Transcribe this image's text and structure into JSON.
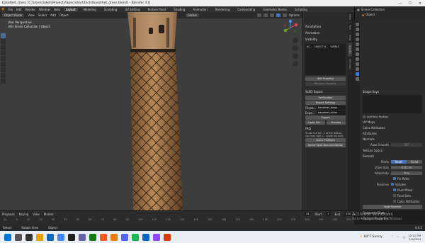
{
  "titlebar": {
    "title": "basethet_dress [C:\\Users\\lakeh\\Projects\\Special\\artifacts\\basethet_dress.blend] - Blender 4.0",
    "min": "—",
    "max": "☐",
    "close": "✕"
  },
  "menubar": {
    "menus": [
      "File",
      "Edit",
      "Render",
      "Window",
      "Help"
    ],
    "workspaces": [
      "Layout",
      "Modeling",
      "Sculpting",
      "UV Editing",
      "Texture Paint",
      "Shading",
      "Animation",
      "Rendering",
      "Compositing",
      "Geometry Nodes",
      "Scripting"
    ],
    "active_workspace": "Layout",
    "scene": "Scene",
    "view_layer": "ViewLayer"
  },
  "viewport": {
    "mode": "Object Mode",
    "menus": [
      "View",
      "Select",
      "Add",
      "Object"
    ],
    "orientation": "Global",
    "options": "Options",
    "view_name": "User Perspective",
    "collection": "(43) Scene Collection | Object"
  },
  "npanel": {
    "sections": {
      "annotation": "Annotation",
      "animation": "Animation",
      "visibility": "Visibility"
    },
    "list_header": [
      "AC...",
      "OBJECT N...",
      "VISIBLE"
    ],
    "add_property": "Add Property",
    "remove_property": "Remove Property",
    "sled_export": "SLED Export",
    "verification": "Verification",
    "export_settings": "Export Settings",
    "filename_label": "Filena...",
    "filename_value": "basethet_dress",
    "export_label": "Expo...",
    "export_value": "basethet_dress",
    "export_button": "Export",
    "open_folder": "Open Fol...",
    "preview": "Preview",
    "faq": "FAQ",
    "faq_line1": "To see the full ...l of the add-on,",
    "faq_line2": "you may sign u... quote account.",
    "quick_platform": "Quick Platform",
    "docs": "Social Tools Documentation",
    "tabs": [
      "Item",
      "Tool",
      "View",
      "SledEx",
      "Skinned..."
    ]
  },
  "outliner": {
    "title": "Scene Collection",
    "item": "Object"
  },
  "properties": {
    "shape_keys": "Shape Keys",
    "add_rest_position": "Add Rest Position",
    "uv_maps": "UV Maps",
    "color_attributes": "Color Attributes",
    "attributes": "Attributes",
    "normals": "Normals",
    "auto_smooth_label": "Auto Smooth",
    "auto_smooth_value": "30°",
    "texture_space": "Texture Space",
    "remesh": "Remesh",
    "mode_label": "Mode",
    "mode_voxel": "Voxel",
    "mode_quad": "Quad",
    "voxel_size_label": "Voxel Size",
    "voxel_size_value": "0.01 m",
    "adaptivity_label": "Adaptivity",
    "adaptivity_value": "0 m",
    "fix_poles": "Fix Poles",
    "preserve_label": "Preserve",
    "preserve_volume": "Volume",
    "paint_mask": "Paint Mask",
    "face_sets": "Face Sets",
    "color_attr2": "Color Attributes",
    "voxel_remesh": "Voxel Remesh",
    "geometry_data": "Geometry Data",
    "custom_properties": "Custom Properties"
  },
  "timeline": {
    "playback": "Playback",
    "keying": "Keying",
    "view": "View",
    "marker": "Marker",
    "current_frame": "43",
    "start_label": "Start",
    "start_value": "1",
    "end_label": "End",
    "end_value": "250",
    "ticks": [
      "-20",
      "0",
      "10",
      "20",
      "30",
      "40",
      "50",
      "60",
      "70",
      "80",
      "90",
      "100",
      "110",
      "120",
      "130",
      "140",
      "150",
      "160",
      "170",
      "180",
      "190",
      "200",
      "210",
      "220",
      "230",
      "240",
      "250"
    ]
  },
  "statusbar": {
    "select": "Select",
    "rotate_view": "Rotate View",
    "object": "Object",
    "version": "4.0.2"
  },
  "watermark": {
    "line1": "Activate Windows",
    "line2": "Go to Settings to activate Windows."
  },
  "taskbar": {
    "weather": "84°F Sunny",
    "time": "12:11 PM",
    "date": "7/4/2024"
  }
}
